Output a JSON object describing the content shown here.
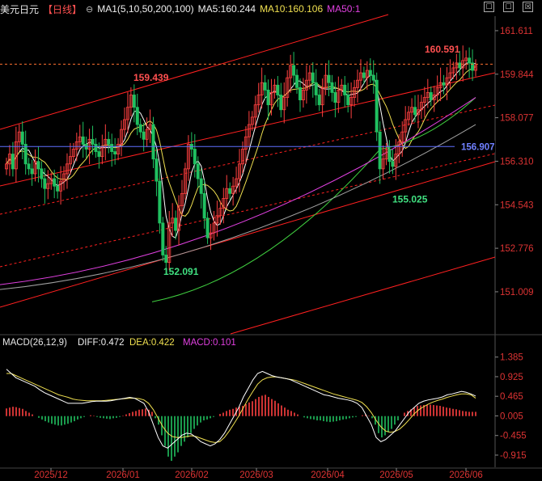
{
  "header": {
    "title": "美元日元",
    "period": "【日线】",
    "circle": "⊖",
    "ma_label": "MA1(5,10,50,200,100)",
    "ma5": "MA5:160.244",
    "ma10": "MA10:160.106",
    "ma50": "MA50:1",
    "icons": [
      "☐",
      "☐",
      "☒"
    ]
  },
  "macd_header": {
    "label": "MACD(26,12,9)",
    "diff": "DIFF:0.472",
    "dea": "DEA:0.422",
    "macd": "MACD:0.101"
  },
  "colors": {
    "up": "#ff4040",
    "down": "#20c060",
    "ma5": "#ffffff",
    "ma10": "#f0e050",
    "ma50": "#e040e0",
    "ma100": "#a0a0a0",
    "ma200": "#40d040",
    "channel": "#ff2020",
    "hline": "#6070ff"
  },
  "chart_data": [
    {
      "type": "candlestick",
      "y_ticks": [
        "161.611",
        "159.844",
        "158.077",
        "156.310",
        "154.543",
        "152.776",
        "151.009"
      ],
      "ylim": [
        149.3,
        162.2
      ],
      "x_ticks": [
        "2025/12",
        "2026/01",
        "2026/02",
        "2026/03",
        "2026/04",
        "2026/05",
        "2026/06"
      ],
      "annotations": [
        {
          "text": "159.439",
          "value": 159.439
        },
        {
          "text": "152.091",
          "value": 152.091
        },
        {
          "text": "155.025",
          "value": 155.025
        },
        {
          "text": "160.591",
          "value": 160.591
        },
        {
          "text": "156.907",
          "value": 156.907
        }
      ],
      "horizontal_line": 156.907,
      "dashed_line": 160.25,
      "close_path": [
        156.2,
        156.6,
        156.0,
        157.1,
        157.5,
        157.0,
        156.2,
        156.0,
        155.8,
        156.3,
        156.0,
        155.6,
        155.2,
        155.4,
        155.6,
        155.3,
        155.1,
        155.5,
        155.8,
        156.2,
        156.5,
        156.8,
        157.1,
        157.3,
        157.0,
        156.8,
        157.2,
        157.0,
        156.7,
        156.5,
        156.9,
        157.2,
        157.0,
        156.7,
        156.6,
        157.0,
        157.6,
        158.0,
        158.5,
        159.0,
        158.5,
        157.8,
        157.5,
        157.2,
        157.6,
        157.8,
        156.4,
        155.5,
        153.8,
        152.5,
        152.2,
        153.8,
        154.0,
        153.5,
        154.5,
        155.0,
        156.0,
        157.0,
        156.8,
        156.2,
        155.6,
        155.0,
        154.0,
        153.2,
        153.4,
        153.8,
        154.1,
        154.4,
        154.8,
        155.2,
        155.0,
        155.3,
        155.6,
        156.2,
        156.8,
        157.3,
        157.8,
        158.1,
        158.6,
        159.0,
        159.5,
        159.2,
        158.6,
        159.1,
        159.4,
        159.0,
        158.4,
        158.9,
        159.7,
        160.2,
        159.8,
        159.3,
        158.8,
        159.2,
        159.6,
        159.9,
        159.5,
        159.0,
        158.6,
        159.3,
        159.8,
        159.5,
        159.1,
        158.7,
        159.2,
        159.4,
        159.0,
        158.6,
        158.9,
        159.3,
        159.6,
        159.9,
        159.7,
        160.0,
        159.8,
        159.6,
        157.5,
        156.0,
        156.4,
        156.8,
        156.3,
        156.1,
        156.6,
        157.1,
        157.5,
        158.0,
        158.3,
        158.5,
        158.2,
        158.4,
        158.7,
        158.9,
        159.1,
        158.8,
        159.0,
        159.3,
        159.5,
        159.4,
        159.7,
        159.9,
        160.1,
        160.3,
        160.1,
        160.4,
        160.5,
        160.3,
        160.0,
        160.2
      ],
      "ma_data": {
        "ma200": [
          150.6,
          156.8,
          158.9
        ],
        "ma100": [
          151.1,
          157.8
        ],
        "ma50": [
          151.3,
          158.9
        ]
      }
    },
    {
      "type": "bar",
      "name": "MACD",
      "y_ticks": [
        "1.385",
        "0.925",
        "0.465",
        "0.005",
        "-0.455",
        "-0.915"
      ],
      "ylim": [
        -1.2,
        1.55
      ],
      "histogram": [
        0.18,
        0.2,
        0.22,
        0.21,
        0.19,
        0.17,
        0.12,
        0.08,
        0.04,
        0.0,
        -0.04,
        -0.08,
        -0.12,
        -0.15,
        -0.18,
        -0.2,
        -0.22,
        -0.22,
        -0.2,
        -0.18,
        -0.15,
        -0.12,
        -0.08,
        -0.05,
        -0.02,
        0.0,
        0.02,
        0.01,
        -0.02,
        -0.04,
        -0.05,
        -0.06,
        -0.07,
        -0.05,
        -0.04,
        -0.02,
        0.01,
        0.04,
        0.07,
        0.1,
        0.12,
        0.15,
        0.16,
        0.18,
        0.15,
        0.1,
        -0.05,
        -0.2,
        -0.45,
        -0.7,
        -0.95,
        -1.05,
        -0.95,
        -0.85,
        -0.7,
        -0.6,
        -0.5,
        -0.4,
        -0.3,
        -0.22,
        -0.15,
        -0.1,
        -0.08,
        -0.05,
        -0.02,
        0.0,
        0.05,
        0.08,
        0.12,
        0.15,
        0.17,
        0.2,
        0.22,
        0.24,
        0.28,
        0.32,
        0.35,
        0.4,
        0.45,
        0.48,
        0.5,
        0.45,
        0.4,
        0.36,
        0.3,
        0.25,
        0.2,
        0.15,
        0.12,
        0.08,
        0.04,
        0.0,
        -0.03,
        -0.05,
        -0.07,
        -0.08,
        -0.1,
        -0.1,
        -0.12,
        -0.13,
        -0.14,
        -0.13,
        -0.12,
        -0.1,
        -0.08,
        -0.07,
        -0.05,
        -0.03,
        -0.02,
        0.0,
        0.02,
        0.04,
        0.01,
        -0.05,
        -0.2,
        -0.4,
        -0.5,
        -0.45,
        -0.38,
        -0.3,
        -0.2,
        -0.1,
        0.0,
        0.08,
        0.12,
        0.16,
        0.2,
        0.24,
        0.25,
        0.26,
        0.27,
        0.27,
        0.26,
        0.25,
        0.24,
        0.22,
        0.2,
        0.19,
        0.17,
        0.16,
        0.14,
        0.12,
        0.11,
        0.1,
        0.1,
        0.1
      ],
      "diff": [
        1.1,
        1.0,
        0.9,
        0.85,
        0.8,
        0.75,
        0.7,
        0.62,
        0.55,
        0.5,
        0.45,
        0.4,
        0.35,
        0.3,
        0.3,
        0.3,
        0.3,
        0.32,
        0.34,
        0.35,
        0.35,
        0.35,
        0.36,
        0.38,
        0.4,
        0.42,
        0.44,
        0.42,
        0.36,
        0.3,
        0.1,
        -0.2,
        -0.5,
        -0.7,
        -0.75,
        -0.65,
        -0.55,
        -0.45,
        -0.4,
        -0.42,
        -0.5,
        -0.6,
        -0.65,
        -0.7,
        -0.65,
        -0.55,
        -0.4,
        -0.2,
        0.0,
        0.2,
        0.45,
        0.65,
        0.85,
        1.0,
        1.05,
        1.0,
        0.95,
        0.92,
        0.9,
        0.88,
        0.85,
        0.8,
        0.75,
        0.7,
        0.65,
        0.6,
        0.55,
        0.5,
        0.48,
        0.45,
        0.42,
        0.4,
        0.38,
        0.35,
        0.3,
        0.2,
        0.0,
        -0.2,
        -0.5,
        -0.6,
        -0.55,
        -0.45,
        -0.35,
        -0.2,
        -0.05,
        0.1,
        0.2,
        0.3,
        0.35,
        0.38,
        0.4,
        0.42,
        0.45,
        0.5,
        0.52,
        0.55,
        0.58,
        0.56,
        0.52,
        0.47
      ],
      "dea": [
        1.0,
        1.0,
        0.95,
        0.9,
        0.85,
        0.8,
        0.75,
        0.7,
        0.65,
        0.6,
        0.55,
        0.5,
        0.47,
        0.44,
        0.4,
        0.38,
        0.37,
        0.36,
        0.36,
        0.36,
        0.36,
        0.37,
        0.38,
        0.39,
        0.4,
        0.41,
        0.42,
        0.42,
        0.41,
        0.38,
        0.3,
        0.15,
        -0.05,
        -0.25,
        -0.4,
        -0.48,
        -0.5,
        -0.5,
        -0.48,
        -0.46,
        -0.48,
        -0.52,
        -0.56,
        -0.6,
        -0.62,
        -0.6,
        -0.5,
        -0.35,
        -0.18,
        0.0,
        0.2,
        0.4,
        0.58,
        0.75,
        0.85,
        0.9,
        0.92,
        0.92,
        0.9,
        0.88,
        0.86,
        0.84,
        0.8,
        0.76,
        0.72,
        0.68,
        0.64,
        0.6,
        0.56,
        0.52,
        0.49,
        0.46,
        0.43,
        0.4,
        0.37,
        0.32,
        0.22,
        0.08,
        -0.1,
        -0.25,
        -0.35,
        -0.38,
        -0.36,
        -0.3,
        -0.2,
        -0.08,
        0.05,
        0.15,
        0.22,
        0.28,
        0.33,
        0.37,
        0.4,
        0.44,
        0.47,
        0.5,
        0.52,
        0.52,
        0.5,
        0.42
      ]
    }
  ]
}
